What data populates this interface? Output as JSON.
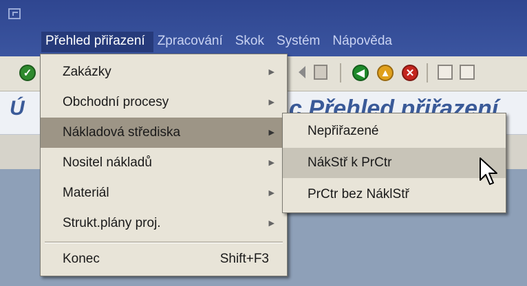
{
  "menubar": {
    "items": [
      {
        "label": "Přehled přiřazení",
        "active": true
      },
      {
        "label": "Zpracování",
        "active": false
      },
      {
        "label": "Skok",
        "active": false
      },
      {
        "label": "Systém",
        "active": false
      },
      {
        "label": "Nápověda",
        "active": false
      }
    ]
  },
  "title_area": {
    "left_fragment": "Ú",
    "right_fragment": "c Přehled přiřazení"
  },
  "dropdown": {
    "items": [
      {
        "label": "Zakázky",
        "has_submenu": true
      },
      {
        "label": "Obchodní procesy",
        "has_submenu": true
      },
      {
        "label": "Nákladová střediska",
        "has_submenu": true,
        "active": true
      },
      {
        "label": "Nositel nákladů",
        "has_submenu": true
      },
      {
        "label": "Materiál",
        "has_submenu": true
      },
      {
        "label": "Strukt.plány proj.",
        "has_submenu": true
      }
    ],
    "exit": {
      "label": "Konec",
      "shortcut": "Shift+F3"
    }
  },
  "submenu": {
    "items": [
      {
        "label": "Nepřiřazené"
      },
      {
        "label": "NákStř k PrCtr",
        "hover": true
      },
      {
        "label": "PrCtr bez NáklStř"
      }
    ]
  },
  "colors": {
    "menubar": "#3b55a0",
    "menu_bg": "#e8e4d8",
    "active_item": "#9d9586",
    "hover_item": "#c8c4b8"
  }
}
